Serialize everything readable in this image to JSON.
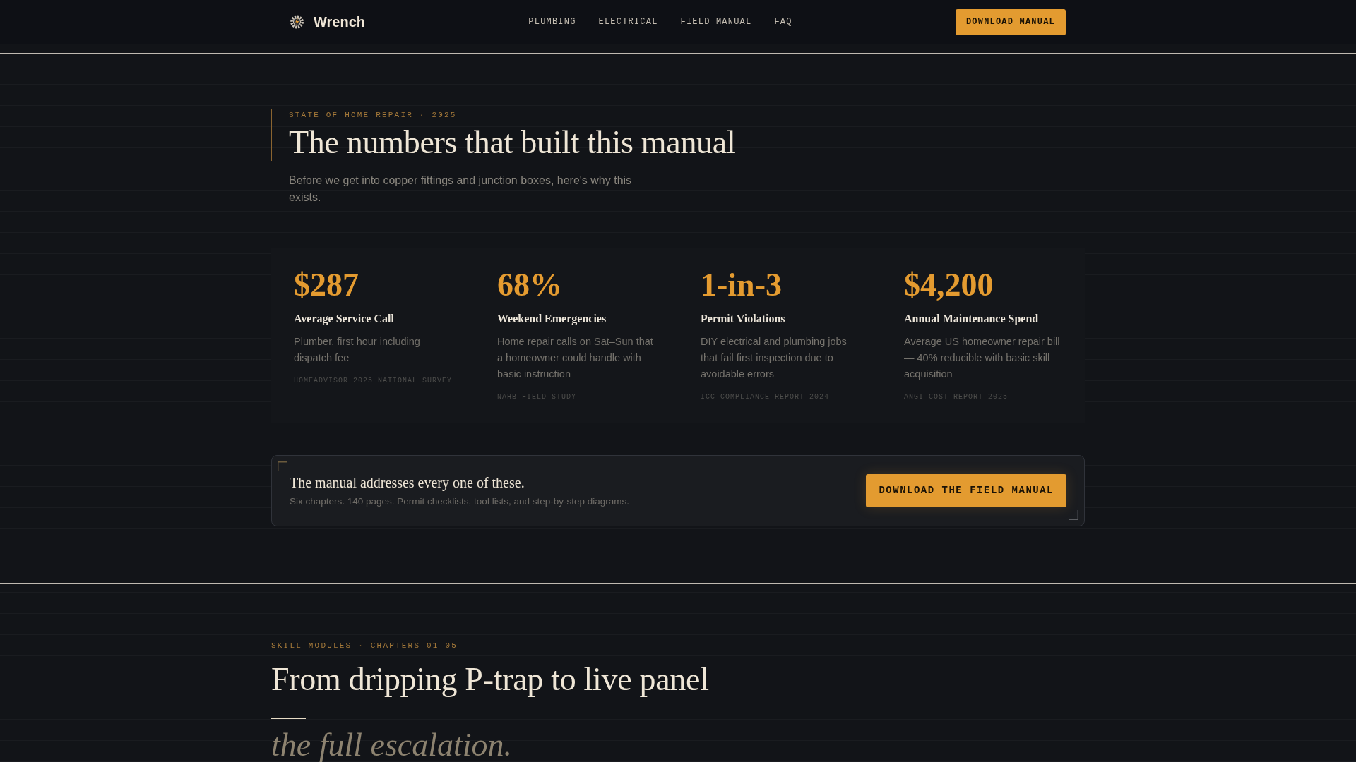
{
  "nav": {
    "brand": "Wrench",
    "links": [
      {
        "label": "PLUMBING"
      },
      {
        "label": "ELECTRICAL"
      },
      {
        "label": "FIELD MANUAL"
      },
      {
        "label": "FAQ"
      }
    ],
    "button": "DOWNLOAD MANUAL"
  },
  "hero": {
    "eyebrow": "STATE OF HOME REPAIR · 2025",
    "title": "The numbers that built this manual",
    "subtitle": "Before we get into copper fittings and junction boxes, here's why this exists."
  },
  "stats": [
    {
      "value": "$287",
      "label": "Average Service Call",
      "description": "Plumber, first hour including dispatch fee",
      "source": "HOMEADVISOR 2025 NATIONAL SURVEY"
    },
    {
      "value": "68%",
      "label": "Weekend Emergencies",
      "description": "Home repair calls on Sat–Sun that a homeowner could handle with basic instruction",
      "source": "NAHB FIELD STUDY"
    },
    {
      "value": "1-in-3",
      "label": "Permit Violations",
      "description": "DIY electrical and plumbing jobs that fail first inspection due to avoidable errors",
      "source": "ICC COMPLIANCE REPORT 2024"
    },
    {
      "value": "$4,200",
      "label": "Annual Maintenance Spend",
      "description": "Average US homeowner repair bill — 40% reducible with basic skill acquisition",
      "source": "ANGI COST REPORT 2025"
    }
  ],
  "callout": {
    "title": "The manual addresses every one of these.",
    "text": "Six chapters. 140 pages. Permit checklists, tool lists, and step-by-step diagrams.",
    "button": "DOWNLOAD THE FIELD MANUAL"
  },
  "modules": {
    "eyebrow": "SKILL MODULES · CHAPTERS 01–05",
    "title": "From dripping P-trap to live panel",
    "subtitle": "the full escalation."
  }
}
